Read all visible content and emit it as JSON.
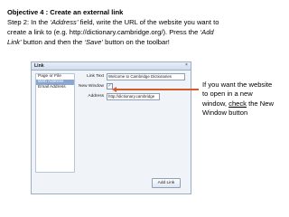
{
  "instruction": {
    "title": "Objective 4 : Create an external link",
    "line1_a": "Step 2:  In the ",
    "line1_b": "‘Address’",
    "line1_c": " field, write the URL of the website you want to",
    "line2": "create a link to (e.g. http://dictionary.cambridge.org/).  Press the ",
    "line2_b": "‘Add",
    "line3_a": "Link’",
    "line3_b": " button and then the ",
    "line3_c": "‘Save’",
    "line3_d": " button on the toolbar!"
  },
  "dialog": {
    "title": "Link",
    "close_glyph": "×",
    "side_items": [
      "Page or File",
      "Web Address",
      "Email Address"
    ],
    "active_side_index": 1,
    "link_text_label": "Link Text",
    "link_text_value": "Welcome to Cambridge Dictionaries",
    "new_window_label": "New Window",
    "new_window_checked_glyph": "✓",
    "address_label": "Address",
    "address_value": "http://dictionary.cambridge",
    "add_link_label": "Add Link"
  },
  "callout": {
    "text_a": "If you want the website to open in a new window, ",
    "text_check": "check",
    "text_b": " the New Window button",
    "arrow_color": "#d35b2a"
  }
}
